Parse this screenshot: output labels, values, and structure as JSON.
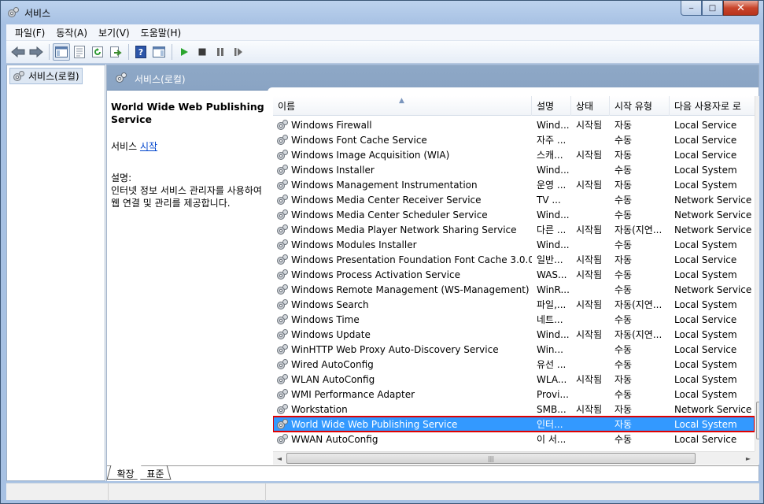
{
  "window": {
    "title": "서비스",
    "controls": {
      "minimize": "‒",
      "maximize": "□",
      "close": "✕"
    }
  },
  "menu": [
    "파일(F)",
    "동작(A)",
    "보기(V)",
    "도움말(H)"
  ],
  "toolbar": {
    "icons": [
      "back-arrow-icon",
      "forward-arrow-icon",
      "console-tree-icon",
      "properties-icon",
      "refresh-icon",
      "export-list-icon",
      "help-icon",
      "show-hide-action-pane-icon",
      "start-service-icon",
      "stop-service-icon",
      "pause-service-icon",
      "resume-service-icon"
    ]
  },
  "tree": {
    "root_label": "서비스(로컬)"
  },
  "pane": {
    "header_title": "서비스(로컬)"
  },
  "details": {
    "title": "World Wide Web Publishing Service",
    "start_prefix": "서비스 ",
    "start_link": "시작",
    "desc_label": "설명:",
    "desc_text": "인터넷 정보 서비스 관리자를 사용하여 웹 연결 및 관리를 제공합니다."
  },
  "columns": [
    "이름",
    "설명",
    "상태",
    "시작 유형",
    "다음 사용자로 로"
  ],
  "services": [
    {
      "name": "Windows Firewall",
      "desc": "Wind...",
      "status": "시작됨",
      "start": "자동",
      "logon": "Local Service"
    },
    {
      "name": "Windows Font Cache Service",
      "desc": "자주 ...",
      "status": "",
      "start": "수동",
      "logon": "Local Service"
    },
    {
      "name": "Windows Image Acquisition (WIA)",
      "desc": "스캐...",
      "status": "시작됨",
      "start": "자동",
      "logon": "Local Service"
    },
    {
      "name": "Windows Installer",
      "desc": "Wind...",
      "status": "",
      "start": "수동",
      "logon": "Local System"
    },
    {
      "name": "Windows Management Instrumentation",
      "desc": "운영 ...",
      "status": "시작됨",
      "start": "자동",
      "logon": "Local System"
    },
    {
      "name": "Windows Media Center Receiver Service",
      "desc": "TV ...",
      "status": "",
      "start": "수동",
      "logon": "Network Service"
    },
    {
      "name": "Windows Media Center Scheduler Service",
      "desc": "Wind...",
      "status": "",
      "start": "수동",
      "logon": "Network Service"
    },
    {
      "name": "Windows Media Player Network Sharing Service",
      "desc": "다른 ...",
      "status": "시작됨",
      "start": "자동(지연...",
      "logon": "Network Service"
    },
    {
      "name": "Windows Modules Installer",
      "desc": "Wind...",
      "status": "",
      "start": "수동",
      "logon": "Local System"
    },
    {
      "name": "Windows Presentation Foundation Font Cache 3.0.0.0",
      "desc": "일반...",
      "status": "시작됨",
      "start": "자동",
      "logon": "Local Service"
    },
    {
      "name": "Windows Process Activation Service",
      "desc": "WAS...",
      "status": "시작됨",
      "start": "수동",
      "logon": "Local System"
    },
    {
      "name": "Windows Remote Management (WS-Management)",
      "desc": "WinR...",
      "status": "",
      "start": "수동",
      "logon": "Network Service"
    },
    {
      "name": "Windows Search",
      "desc": "파일,...",
      "status": "시작됨",
      "start": "자동(지연...",
      "logon": "Local System"
    },
    {
      "name": "Windows Time",
      "desc": "네트...",
      "status": "",
      "start": "수동",
      "logon": "Local Service"
    },
    {
      "name": "Windows Update",
      "desc": "Wind...",
      "status": "시작됨",
      "start": "자동(지연...",
      "logon": "Local System"
    },
    {
      "name": "WinHTTP Web Proxy Auto-Discovery Service",
      "desc": "Win...",
      "status": "",
      "start": "수동",
      "logon": "Local Service"
    },
    {
      "name": "Wired AutoConfig",
      "desc": "유선 ...",
      "status": "",
      "start": "수동",
      "logon": "Local System"
    },
    {
      "name": "WLAN AutoConfig",
      "desc": "WLA...",
      "status": "시작됨",
      "start": "자동",
      "logon": "Local System"
    },
    {
      "name": "WMI Performance Adapter",
      "desc": "Provi...",
      "status": "",
      "start": "수동",
      "logon": "Local System"
    },
    {
      "name": "Workstation",
      "desc": "SMB...",
      "status": "시작됨",
      "start": "자동",
      "logon": "Network Service"
    },
    {
      "name": "World Wide Web Publishing Service",
      "desc": "인터...",
      "status": "",
      "start": "자동",
      "logon": "Local System",
      "selected": true
    },
    {
      "name": "WWAN AutoConfig",
      "desc": "이 서...",
      "status": "",
      "start": "수동",
      "logon": "Local Service"
    }
  ],
  "tabs": [
    "확장",
    "표준"
  ],
  "scroll": {
    "up": "▲",
    "down": "▼",
    "left": "◄",
    "right": "►",
    "grip": "|||"
  },
  "colors": {
    "selection": "#3399ff",
    "highlight_border": "#e00000",
    "link": "#0044cc"
  }
}
